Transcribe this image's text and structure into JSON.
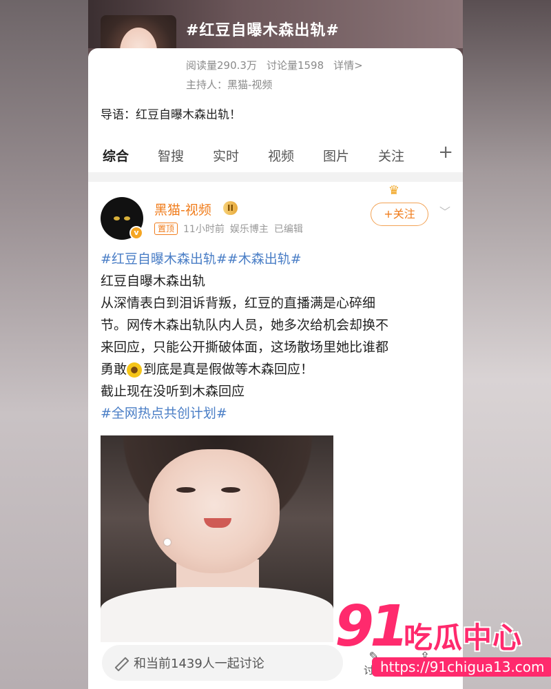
{
  "topic": {
    "title": "#红豆自曝木森出轨#",
    "reads": "阅读量290.3万",
    "discussions": "讨论量1598",
    "details": "详情>",
    "host": "主持人：黑猫-视频",
    "lead": "导语：红豆自曝木森出轨！"
  },
  "tabs": [
    "综合",
    "智搜",
    "实时",
    "视频",
    "图片",
    "关注"
  ],
  "post": {
    "username": "黑猫-视频",
    "vip": "II",
    "pinned": "置顶",
    "time": "11小时前",
    "role": "娱乐博主",
    "edited": "已编辑",
    "follow": "+关注",
    "lines": [
      "#红豆自曝木森出轨##木森出轨#",
      "红豆自曝木森出轨",
      "从深情表白到泪诉背叛，红豆的直播满是心碎细",
      "节。网传木森出轨队内人员，她多次给机会却换不",
      "来回应，只能公开撕破体面，这场散场里她比谁都",
      "到底是真是假做等木森回应！",
      "截止现在没听到木森回应",
      "#全网热点共创计划#"
    ],
    "line5_prefix": "勇敢"
  },
  "comment": {
    "placeholder": "和当前1439人一起讨论",
    "discuss": "讨论",
    "share": "分享"
  },
  "watermark": {
    "num": "91",
    "text": "吃瓜中心",
    "url": "https://91chigua13.com"
  }
}
